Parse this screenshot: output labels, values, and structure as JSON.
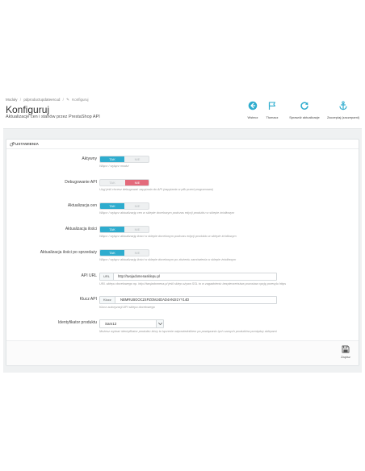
{
  "breadcrumb": {
    "items": [
      "Moduły",
      "pdproductupdateercud",
      "Konfiguruj"
    ],
    "separator": "/",
    "edit_glyph": "✎"
  },
  "header": {
    "title": "Konfiguruj",
    "subtitle": "Aktualizacje cen i stanów przez PrestaShop API"
  },
  "toolbar": {
    "back_label": "Wstecz",
    "translate_label": "Tłumacz",
    "check_label": "Sprawdź aktualizacje",
    "hooks_label": "Zaczepiaj (zaczepami)"
  },
  "panel": {
    "title": "USTAWIENIA",
    "yes": "TAK",
    "no": "NIE",
    "active": {
      "label": "Aktywny",
      "help": "Włącz / wyłącz moduł",
      "value": "yes"
    },
    "debug": {
      "label": "Debugowanie API",
      "help": "Użyj jeśli chcesz debugować zapytania do API (zapytania w plik przed programowe)",
      "value": "no"
    },
    "price_update": {
      "label": "Aktualizacja cen",
      "help": "Włącz / wyłącz aktualizację cen w sklepie docelowym podczas edycji produktu w sklepie źródłowym",
      "value": "yes"
    },
    "qty_update": {
      "label": "Aktualizacja ilości",
      "help": "Włącz / wyłącz aktualizację ilości w sklepie docelowym podczas edycji produktu w sklepie źródłowym",
      "value": "yes"
    },
    "qty_after_sale": {
      "label": "Aktualizacja ilości po sprzedaży",
      "help": "Włącz / wyłącz aktualizację ilości w sklepie docelowym po złożeniu zamówienia w sklepie źródłowym",
      "value": "yes"
    },
    "api_url": {
      "label": "API URL",
      "addon": "URL",
      "value": "http://twojadomenasklepu.pl",
      "help": "URL sklepu docelowego np. http://twojadomena.pl jeśli sklep używa SSL to w zagadnieniu bezpieczeństwa pozostaw opcję przesyłu https"
    },
    "api_key": {
      "label": "Klucz API",
      "addon": "Klucz",
      "value": "NBMRUBGOCZ4PZOMJ4DAD4AN3I1YY14D",
      "help": "Klucz autoryzacji API sklepu docelowego"
    },
    "identifier": {
      "label": "Identyfikator produktu",
      "value": "Sam12",
      "help": "Możesz wybrać identyfikator produktu który to łączenie odpowiednikiem po powiązaniu tych samych produktów pomiędzy sklepami"
    },
    "save_label": "Zapisz"
  },
  "colors": {
    "accent": "#2eacce",
    "danger": "#e36a7b",
    "background": "#eff1f2"
  }
}
